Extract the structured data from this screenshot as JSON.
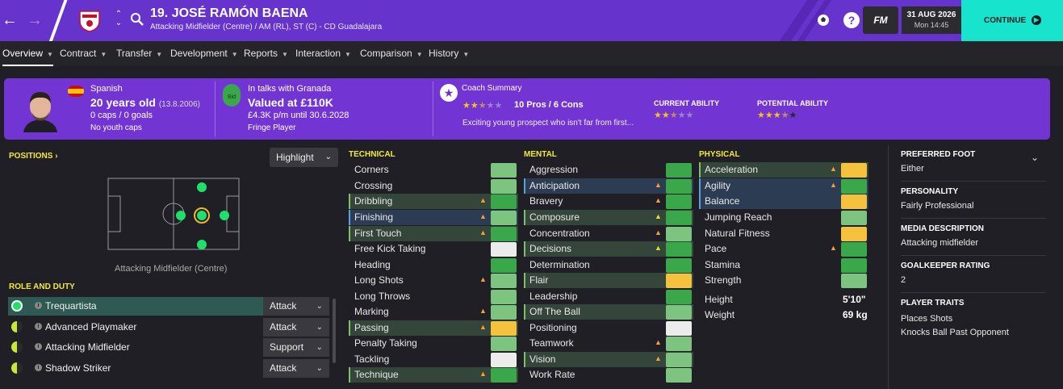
{
  "topbar": {
    "back_icon": "arrow-left-icon",
    "forward_icon": "arrow-right-icon",
    "player_name": "19. JOSÉ RAMÓN BAENA",
    "player_positions": "Attacking Midfielder (Centre) / AM (RL), ST (C) - CD Guadalajara",
    "date": "31 AUG 2026",
    "time": "Mon 14:45",
    "fm_label": "FM",
    "continue_label": "CONTINUE",
    "accent_color": "#6633cc",
    "continue_color": "#18e4cd"
  },
  "tabs": [
    {
      "label": "Overview"
    },
    {
      "label": "Contract"
    },
    {
      "label": "Transfer"
    },
    {
      "label": "Development"
    },
    {
      "label": "Reports"
    },
    {
      "label": "Interaction"
    },
    {
      "label": "Comparison"
    },
    {
      "label": "History"
    }
  ],
  "header": {
    "nationality": "Spanish",
    "age": "20 years old",
    "dob": "(13.8.2006)",
    "caps": "0 caps / 0 goals",
    "youth_caps": "No youth caps",
    "bid_icon_text": "Bid",
    "talks": "In talks with Granada",
    "value": "Valued at £110K",
    "wage": "£4.3K p/m until 30.6.2028",
    "squad_status": "Fringe Player",
    "coach_summary_label": "Coach Summary",
    "pros_cons": "10 Pros / 6 Cons",
    "coach_text": "Exciting young prospect who isn't far from first...",
    "coach_stars": 2.5,
    "current_ability_label": "CURRENT ABILITY",
    "current_ability_stars": 2.5,
    "potential_ability_label": "POTENTIAL ABILITY",
    "potential_ability_stars": 3.5
  },
  "positions": {
    "title": "POSITIONS",
    "highlight_label": "Highlight",
    "caption": "Attacking Midfielder (Centre)"
  },
  "roles": {
    "title": "ROLE AND DUTY",
    "items": [
      {
        "name": "Trequartista",
        "duty": "Attack"
      },
      {
        "name": "Advanced Playmaker",
        "duty": "Attack"
      },
      {
        "name": "Attacking Midfielder",
        "duty": "Support"
      },
      {
        "name": "Shadow Striker",
        "duty": "Attack"
      }
    ]
  },
  "technical": {
    "title": "TECHNICAL",
    "items": [
      {
        "name": "Corners",
        "color": "lgreen"
      },
      {
        "name": "Crossing",
        "color": "lgreen"
      },
      {
        "name": "Dribbling",
        "color": "green"
      },
      {
        "name": "Finishing",
        "color": "lgreen"
      },
      {
        "name": "First Touch",
        "color": "green"
      },
      {
        "name": "Free Kick Taking",
        "color": "white"
      },
      {
        "name": "Heading",
        "color": "green"
      },
      {
        "name": "Long Shots",
        "color": "lgreen"
      },
      {
        "name": "Long Throws",
        "color": "lgreen"
      },
      {
        "name": "Marking",
        "color": "lgreen"
      },
      {
        "name": "Passing",
        "color": "yellow"
      },
      {
        "name": "Penalty Taking",
        "color": "lgreen"
      },
      {
        "name": "Tackling",
        "color": "white"
      },
      {
        "name": "Technique",
        "color": "green"
      }
    ]
  },
  "mental": {
    "title": "MENTAL",
    "items": [
      {
        "name": "Aggression",
        "color": "green"
      },
      {
        "name": "Anticipation",
        "color": "green"
      },
      {
        "name": "Bravery",
        "color": "green"
      },
      {
        "name": "Composure",
        "color": "green"
      },
      {
        "name": "Concentration",
        "color": "lgreen"
      },
      {
        "name": "Decisions",
        "color": "green"
      },
      {
        "name": "Determination",
        "color": "green"
      },
      {
        "name": "Flair",
        "color": "yellow"
      },
      {
        "name": "Leadership",
        "color": "green"
      },
      {
        "name": "Off The Ball",
        "color": "lgreen"
      },
      {
        "name": "Positioning",
        "color": "white"
      },
      {
        "name": "Teamwork",
        "color": "lgreen"
      },
      {
        "name": "Vision",
        "color": "lgreen"
      },
      {
        "name": "Work Rate",
        "color": "lgreen"
      }
    ]
  },
  "physical": {
    "title": "PHYSICAL",
    "items": [
      {
        "name": "Acceleration",
        "color": "yellow"
      },
      {
        "name": "Agility",
        "color": "green"
      },
      {
        "name": "Balance",
        "color": "yellow"
      },
      {
        "name": "Jumping Reach",
        "color": "lgreen"
      },
      {
        "name": "Natural Fitness",
        "color": "yellow"
      },
      {
        "name": "Pace",
        "color": "green"
      },
      {
        "name": "Stamina",
        "color": "green"
      },
      {
        "name": "Strength",
        "color": "lgreen"
      }
    ],
    "height_label": "Height",
    "height": "5'10\"",
    "weight_label": "Weight",
    "weight": "69 kg"
  },
  "info": {
    "preferred_foot_label": "PREFERRED FOOT",
    "preferred_foot": "Either",
    "personality_label": "PERSONALITY",
    "personality": "Fairly Professional",
    "media_label": "MEDIA DESCRIPTION",
    "media": "Attacking midfielder",
    "gk_label": "GOALKEEPER RATING",
    "gk": "2",
    "traits_label": "PLAYER TRAITS",
    "traits": [
      "Places Shots",
      "Knocks Ball Past Opponent"
    ]
  }
}
